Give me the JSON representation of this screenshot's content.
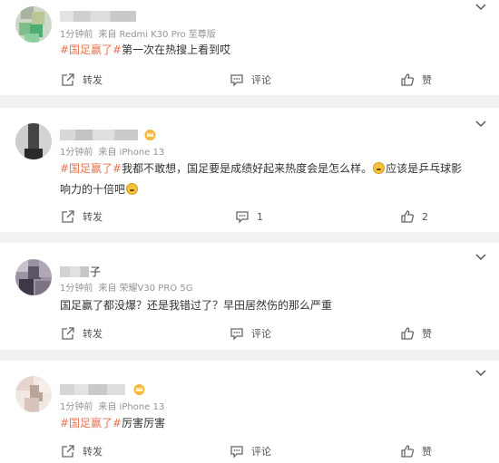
{
  "comments": [
    {
      "username_visible": "",
      "time": "1分钟前",
      "source": "来自 Redmi K30 Pro 至尊版",
      "hashtag": "#国足赢了#",
      "text": "第一次在热搜上看到哎",
      "repost_label": "转发",
      "comment_label": "评论",
      "comment_count": "",
      "like_label": "赞",
      "like_count": ""
    },
    {
      "username_visible": "",
      "time": "1分钟前",
      "source": "来自 iPhone 13",
      "hashtag": "#国足赢了#",
      "text": "我都不敢想，国足要是成绩好起来热度会是怎么样。",
      "text2": "应该是乒乓球影响力的十倍吧",
      "repost_label": "转发",
      "comment_label": "",
      "comment_count": "1",
      "like_label": "",
      "like_count": "2"
    },
    {
      "username_visible": "子",
      "time": "1分钟前",
      "source": "来自 荣耀V30 PRO 5G",
      "hashtag": "",
      "text": "国足赢了都没爆？还是我错过了？早田居然伤的那么严重",
      "repost_label": "转发",
      "comment_label": "评论",
      "comment_count": "",
      "like_label": "赞",
      "like_count": ""
    },
    {
      "username_visible": "",
      "time": "1分钟前",
      "source": "来自 iPhone 13",
      "hashtag": "#国足赢了#",
      "text": "厉害厉害",
      "repost_label": "转发",
      "comment_label": "评论",
      "comment_count": "",
      "like_label": "赞",
      "like_count": ""
    }
  ],
  "colors": {
    "hashtag": "#eb7350",
    "meta": "#939393",
    "page_bg": "#f2f2f2"
  },
  "icons": [
    "repost-icon",
    "comment-icon",
    "like-icon",
    "chevron-down-icon",
    "crown-badge-icon"
  ]
}
